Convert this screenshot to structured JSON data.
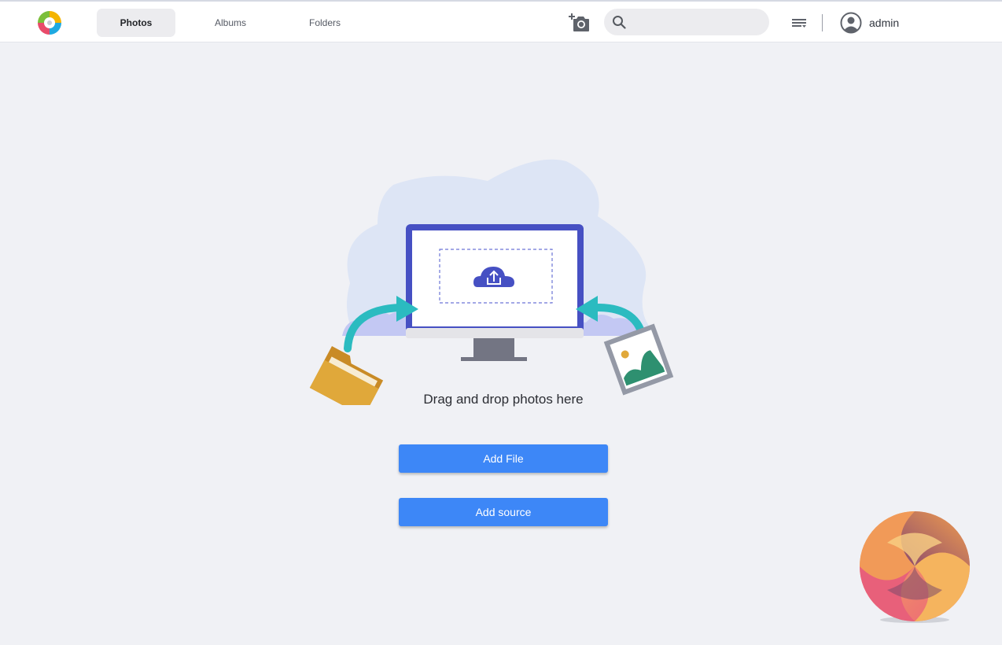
{
  "header": {
    "tabs": [
      {
        "label": "Photos",
        "active": true
      },
      {
        "label": "Albums",
        "active": false
      },
      {
        "label": "Folders",
        "active": false
      }
    ],
    "search": {
      "value": "",
      "placeholder": ""
    },
    "user": {
      "name": "admin"
    },
    "icons": {
      "logo": "app-logo",
      "add_camera": "add-camera-icon",
      "search": "search-icon",
      "list": "list-filter-icon",
      "avatar": "user-avatar-icon"
    }
  },
  "main": {
    "drop_text": "Drag and drop photos here",
    "add_file_label": "Add File",
    "add_source_label": "Add source"
  },
  "colors": {
    "accent": "#3d87f7",
    "background": "#f0f1f5",
    "monitor_frame": "#4650c3",
    "arrow": "#2bbbc0",
    "folder": "#e0a83a"
  }
}
